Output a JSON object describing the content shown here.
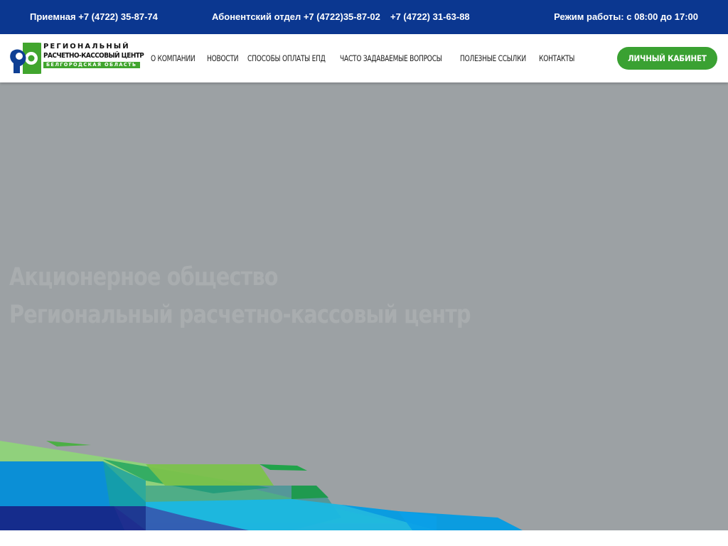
{
  "topbar": {
    "reception": "Приемная +7 (4722) 35-87-74",
    "subscriber": "Абонентский отдел +7 (4722)35-87-02",
    "phone3": "+7 (4722) 31-63-88",
    "hours": "Режим работы: с 08:00 до 17:00"
  },
  "logo": {
    "line1": "РЕГИОНАЛЬНЫЙ",
    "line2": "РАСЧЕТНО-КАССОВЫЙ ЦЕНТР",
    "line3": "БЕЛГОРОДСКАЯ ОБЛАСТЬ"
  },
  "nav": {
    "items": [
      {
        "label": "О КОМПАНИИ"
      },
      {
        "label": "НОВОСТИ"
      },
      {
        "label": "СПОСОБЫ ОПЛАТЫ ЕПД"
      },
      {
        "label": "ЧАСТО ЗАДАВАЕМЫЕ ВОПРОСЫ"
      },
      {
        "label": "ПОЛЕЗНЫЕ ССЫЛКИ"
      },
      {
        "label": "КОНТАКТЫ"
      }
    ]
  },
  "cabinet": {
    "label": "ЛИЧНЫЙ КАБИНЕТ"
  },
  "hero": {
    "title_line1": "Акционерное общество",
    "title_line2": "Региональный расчетно-кассовый центр"
  },
  "colors": {
    "topbar": "#0b3790",
    "accent_green": "#3aa132",
    "hero_bg": "#9ca1a4",
    "logo_blue": "#0e3f94",
    "logo_green": "#41a52e"
  },
  "icons": {
    "logo": "rrc-logo-icon"
  }
}
